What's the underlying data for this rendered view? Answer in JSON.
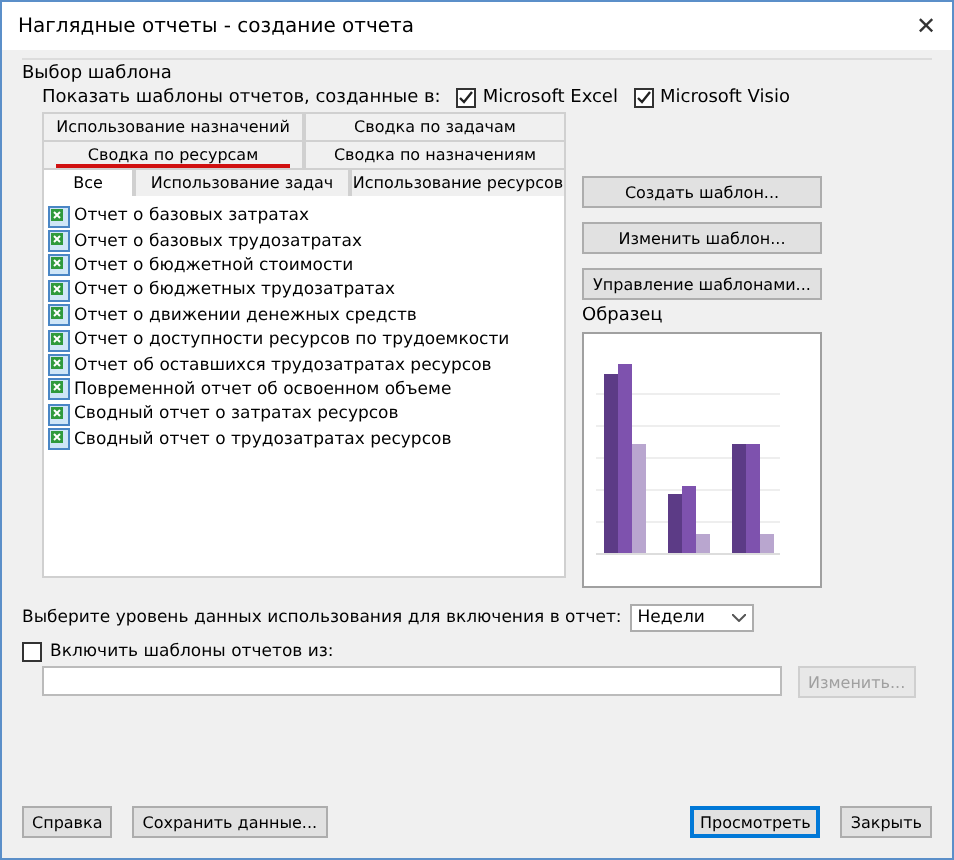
{
  "window": {
    "title": "Наглядные отчеты - создание отчета",
    "close": "✕"
  },
  "group_title": "Выбор шаблона",
  "show_templates": {
    "label": "Показать шаблоны отчетов, созданные в:",
    "options": [
      {
        "label": "Microsoft Excel",
        "checked": true
      },
      {
        "label": "Microsoft Visio",
        "checked": true
      }
    ]
  },
  "tab_rows": [
    [
      {
        "label": "Использование назначений",
        "selected": false,
        "annotated": false
      },
      {
        "label": "Сводка по задачам",
        "selected": false,
        "annotated": false
      }
    ],
    [
      {
        "label": "Сводка по ресурсам",
        "selected": false,
        "annotated": true
      },
      {
        "label": "Сводка по назначениям",
        "selected": false,
        "annotated": false
      }
    ],
    [
      {
        "label": "Все",
        "selected": true,
        "annotated": false
      },
      {
        "label": "Использование задач",
        "selected": false,
        "annotated": false
      },
      {
        "label": "Использование ресурсов",
        "selected": false,
        "annotated": false
      }
    ]
  ],
  "reports": [
    {
      "label": "Отчет о базовых затратах",
      "selected": false
    },
    {
      "label": "Отчет о базовых трудозатратах",
      "selected": false
    },
    {
      "label": "Отчет о бюджетной стоимости",
      "selected": false
    },
    {
      "label": "Отчет о бюджетных трудозатратах",
      "selected": false
    },
    {
      "label": "Отчет о движении денежных средств",
      "selected": false
    },
    {
      "label": "Отчет о доступности ресурсов по трудоемкости",
      "selected": false
    },
    {
      "label": "Отчет об оставшихся трудозатратах ресурсов",
      "selected": false
    },
    {
      "label": "Повременной отчет об освоенном объеме",
      "selected": false
    },
    {
      "label": "Сводный отчет о затратах ресурсов",
      "selected": false
    },
    {
      "label": "Сводный отчет о трудозатратах ресурсов",
      "selected": false
    }
  ],
  "side_buttons": [
    {
      "label": "Создать шаблон...",
      "disabled": false
    },
    {
      "label": "Изменить шаблон...",
      "disabled": false
    },
    {
      "label": "Управление шаблонами...",
      "disabled": false
    }
  ],
  "preview": {
    "label": "Образец"
  },
  "usage_level": {
    "label": "Выберите уровень данных использования для включения в отчет:",
    "value": "Недели"
  },
  "include_templates": {
    "label": "Включить шаблоны отчетов из:",
    "checked": false,
    "button": {
      "label": "Изменить...",
      "disabled": true
    }
  },
  "footer_buttons": [
    {
      "label": "Справка",
      "default": false
    },
    {
      "label": "Сохранить данные...",
      "default": false
    },
    {
      "label": "Просмотреть",
      "default": true
    },
    {
      "label": "Закрыть",
      "default": false
    }
  ]
}
